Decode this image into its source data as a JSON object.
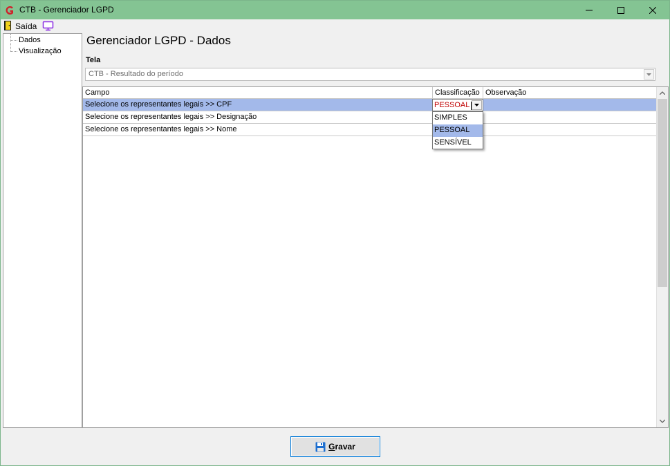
{
  "window": {
    "title": "CTB - Gerenciador LGPD"
  },
  "menu": {
    "exit_label": "Saída"
  },
  "tree": {
    "items": [
      {
        "label": "Dados"
      },
      {
        "label": "Visualização"
      }
    ]
  },
  "page": {
    "title": "Gerenciador LGPD - Dados",
    "tela_label": "Tela",
    "tela_value": "CTB - Resultado do período"
  },
  "grid": {
    "columns": [
      "Campo",
      "Classificação",
      "Observação"
    ],
    "rows": [
      {
        "campo": "Selecione os representantes legais >> CPF",
        "classificacao": "PESSOAL",
        "observacao": ""
      },
      {
        "campo": "Selecione os representantes legais >> Designação",
        "classificacao": "",
        "observacao": ""
      },
      {
        "campo": "Selecione os representantes legais >> Nome",
        "classificacao": "",
        "observacao": ""
      }
    ],
    "editor_value": "PESSOAL",
    "dropdown_options": [
      "SIMPLES",
      "PESSOAL",
      "SENSÍVEL"
    ],
    "dropdown_highlighted": "PESSOAL"
  },
  "footer": {
    "save_first_letter": "G",
    "save_rest": "ravar"
  },
  "colors": {
    "titlebar": "#84c493",
    "selection": "#a3b9ea",
    "editor_text": "#c00000",
    "accent_border": "#0078d7"
  }
}
